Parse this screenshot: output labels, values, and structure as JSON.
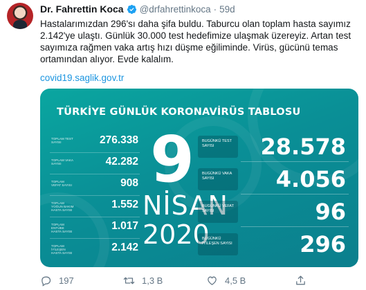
{
  "author": {
    "name": "Dr. Fahrettin Koca",
    "handle": "@drfahrettinkoca",
    "time": "59d",
    "separator": "·",
    "verified_icon": "verified-badge-icon"
  },
  "tweet": {
    "text": "Hastalarımızdan 296'sı daha şifa buldu. Taburcu olan toplam hasta sayımız 2.142'ye ulaştı. Günlük 30.000 test hedefimize ulaşmak üzereyiz. Artan test sayımıza rağmen vaka artış hızı düşme eğiliminde. Virüs, gücünü temas ortamından alıyor. Evde kalalım.",
    "link": "covid19.saglik.gov.tr"
  },
  "card": {
    "title": "TÜRKİYE GÜNLÜK KORONAVİRÜS TABLOSU",
    "date": {
      "day": "9",
      "month": "NİSAN",
      "year": "2020"
    },
    "left_stats": [
      {
        "label": "TOPLAM TEST SAYISI",
        "value": "276.338"
      },
      {
        "label": "TOPLAM VAKA SAYISI",
        "value": "42.282"
      },
      {
        "label": "TOPLAM VEFAT SAYISI",
        "value": "908"
      },
      {
        "label": "TOPLAM YOĞUN BAKIM HASTA SAYISI",
        "value": "1.552"
      },
      {
        "label": "TOPLAM ENTÜBE HASTA SAYISI",
        "value": "1.017"
      },
      {
        "label": "TOPLAM İYİLEŞEN HASTA SAYISI",
        "value": "2.142"
      }
    ],
    "right_stats": [
      {
        "label": "BUGÜNKÜ TEST SAYISI",
        "value": "28.578"
      },
      {
        "label": "BUGÜNKÜ VAKA SAYISI",
        "value": "4.056"
      },
      {
        "label": "BUGÜNKÜ VEFAT SAYISI",
        "value": "96"
      },
      {
        "label": "BUGÜNKÜ İYİLEŞEN SAYISI",
        "value": "296"
      }
    ]
  },
  "actions": {
    "reply": {
      "icon": "reply-icon",
      "count": "197"
    },
    "retweet": {
      "icon": "retweet-icon",
      "count": "1,3 B"
    },
    "like": {
      "icon": "heart-icon",
      "count": "4,5 B"
    },
    "share": {
      "icon": "share-icon"
    }
  },
  "colors": {
    "link": "#1b95e0",
    "muted": "#657786",
    "card_teal": "#0a8f96",
    "verified": "#1da1f2"
  }
}
